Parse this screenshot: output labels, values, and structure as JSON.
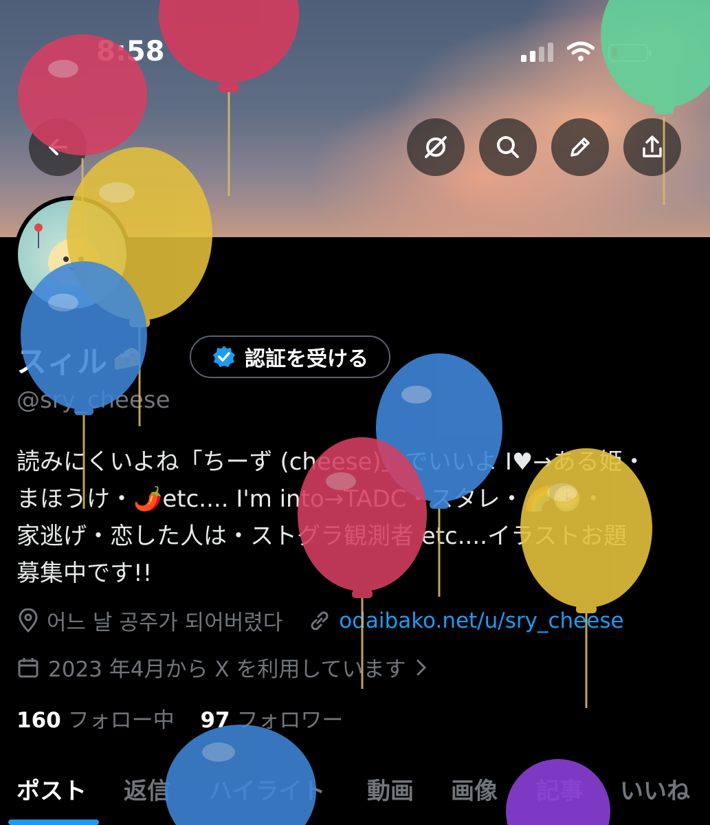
{
  "status_bar": {
    "time": "8:58"
  },
  "profile": {
    "display_name": "スィル",
    "name_emoji": "🧀",
    "verify_button": "認証を受ける",
    "handle": "@sry_cheese",
    "bio": [
      "読みにくいよね「ちーず (cheese)」でいいよ I♥→ある姫・",
      "まほうけ・🌶️etc.... I'm into→TADC・スタレ・🌈🕒・",
      "家逃げ・恋した人は・ストグラ観測者 etc....イラストお題",
      "募集中です!!"
    ],
    "location": "어느 날 공주가 되어버렸다",
    "website": "odaibako.net/u/sry_cheese",
    "joined": "2023 年4月から X を利用しています"
  },
  "stats": {
    "following_count": "160",
    "following_label": "フォロー中",
    "followers_count": "97",
    "followers_label": "フォロワー"
  },
  "tabs": [
    "ポスト",
    "返信",
    "ハイライト",
    "動画",
    "画像",
    "記事",
    "いいね"
  ],
  "header_icons": [
    "back-arrow-icon",
    "grok-icon",
    "search-icon",
    "edit-icon",
    "share-icon"
  ],
  "colors": {
    "accent": "#1d9bf0",
    "background": "#000000",
    "muted": "#71767b"
  }
}
